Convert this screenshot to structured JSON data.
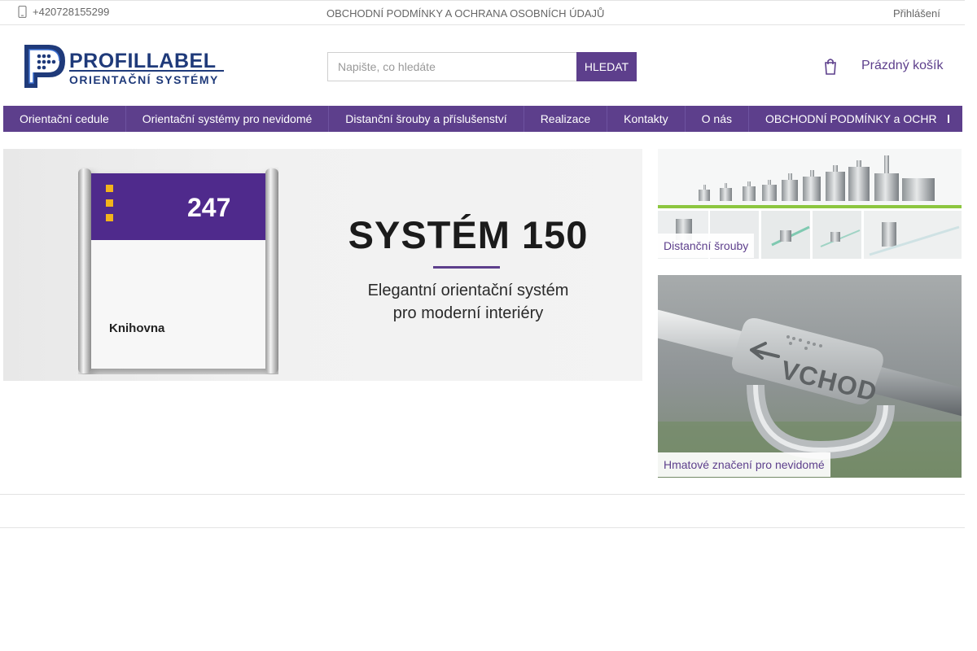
{
  "topbar": {
    "phone": "+420728155299",
    "terms_link": "OBCHODNÍ PODMÍNKY A OCHRANA OSOBNÍCH ÚDAJŮ",
    "login": "Přihlášení"
  },
  "logo": {
    "brand": "PROFILLABEL",
    "tagline": "ORIENTAČNÍ SYSTÉMY"
  },
  "search": {
    "placeholder": "Napište, co hledáte",
    "button": "HLEDAT"
  },
  "cart": {
    "label": "Prázdný košík",
    "icon": "cart-icon"
  },
  "nav": {
    "items": [
      {
        "label": "Orientační cedule"
      },
      {
        "label": "Orientační systémy pro nevidomé"
      },
      {
        "label": "Distanční šrouby a příslušenství"
      },
      {
        "label": "Realizace"
      },
      {
        "label": "Kontakty"
      },
      {
        "label": "O nás"
      },
      {
        "label": "OBCHODNÍ PODMÍNKY a OCHRANA OSOBNÍCH ÚDAJŮ"
      }
    ],
    "more_icon": "chevron-right-icon"
  },
  "banner": {
    "sign_number": "247",
    "sign_room": "Knihovna",
    "title": "SYSTÉM 150",
    "subtitle_line1": "Elegantní orientační systém",
    "subtitle_line2": "pro moderní interiéry"
  },
  "tiles": [
    {
      "label": "Distanční šrouby"
    },
    {
      "label": "Hmatové značení pro nevidomé",
      "sign_text": "VCHOD"
    }
  ],
  "colors": {
    "brand_purple": "#5d3f8c",
    "logo_blue": "#1f3a7a",
    "accent_yellow": "#f2b41c",
    "accent_green": "#8cc63f"
  }
}
